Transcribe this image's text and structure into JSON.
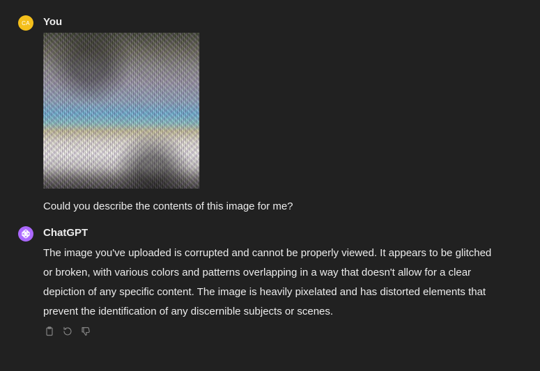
{
  "user_message": {
    "avatar_initials": "CA",
    "avatar_color": "#f4bf1b",
    "author": "You",
    "attachment_icon": "uploaded-image",
    "text": "Could you describe the contents of this image for me?"
  },
  "assistant_message": {
    "avatar_icon": "openai-logo-icon",
    "avatar_color": "#ab68ff",
    "author": "ChatGPT",
    "lines": [
      "The image you've uploaded is corrupted and cannot be properly viewed. It appears to be glitched",
      "or broken, with various colors and patterns overlapping in a way that doesn't allow for a clear",
      "depiction of any specific content. The image is heavily pixelated and has distorted elements that",
      "prevent the identification of any discernible subjects or scenes."
    ],
    "actions": [
      {
        "icon": "clipboard-icon"
      },
      {
        "icon": "regenerate-icon"
      },
      {
        "icon": "thumbs-down-icon"
      }
    ]
  },
  "colors": {
    "background": "#212121",
    "text": "#ececec",
    "icon": "#8e8e8e"
  }
}
